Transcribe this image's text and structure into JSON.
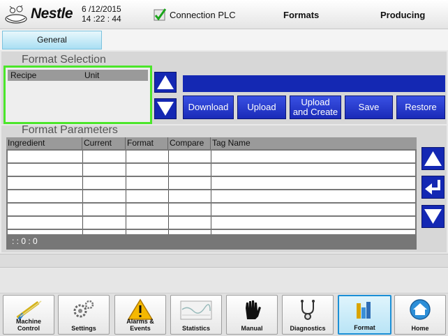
{
  "header": {
    "brand": "Nestle",
    "date": "6 /12/2015",
    "time": "14 :22 : 44",
    "connection": "Connection PLC",
    "screen": "Formats",
    "state": "Producing"
  },
  "tabs": [
    {
      "label": "General"
    }
  ],
  "format_selection": {
    "title": "Format Selection",
    "columns": [
      "Recipe",
      "Unit"
    ],
    "buttons": [
      "Download",
      "Upload",
      "Upload and Create",
      "Save",
      "Restore"
    ]
  },
  "format_parameters": {
    "title": "Format Parameters",
    "columns": [
      "Ingredient",
      "Current",
      "Format",
      "Compare",
      "Tag Name"
    ],
    "footer": ": : 0 : 0"
  },
  "nav": [
    {
      "label": "Machine Control",
      "icon": "machine-control-icon"
    },
    {
      "label": "Settings",
      "icon": "settings-icon"
    },
    {
      "label": "Alarms & Events",
      "icon": "alarm-icon"
    },
    {
      "label": "Statistics",
      "icon": "statistics-icon"
    },
    {
      "label": "Manual",
      "icon": "hand-icon"
    },
    {
      "label": "Diagnostics",
      "icon": "stethoscope-icon"
    },
    {
      "label": "Format",
      "icon": "format-icon"
    },
    {
      "label": "Home",
      "icon": "home-icon"
    }
  ],
  "colors": {
    "accent_blue": "#1428b3",
    "selection_green": "#4be62a",
    "active_tab": "#1b8fd6"
  }
}
